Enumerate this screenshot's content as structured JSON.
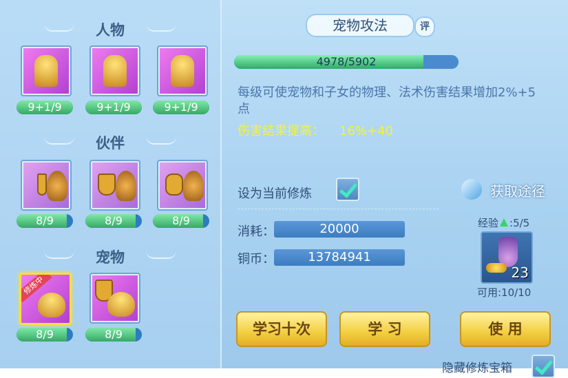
{
  "left": {
    "sections": [
      {
        "title": "人物",
        "cards": [
          {
            "name": "meditating-figure",
            "level": "9+1/9",
            "progress": 1
          },
          {
            "name": "shield-figure",
            "level": "9+1/9",
            "progress": 1
          },
          {
            "name": "warrior-figure",
            "level": "9+1/9",
            "progress": 1
          }
        ]
      },
      {
        "title": "伙伴",
        "cards": [
          {
            "name": "sword-tiger",
            "level": "8/9",
            "progress": 0.889
          },
          {
            "name": "shield-tiger",
            "level": "8/9",
            "progress": 0.889
          },
          {
            "name": "gauntlet-tiger",
            "level": "8/9",
            "progress": 0.889
          }
        ]
      },
      {
        "title": "宠物",
        "cards": [
          {
            "name": "sword-cat",
            "level": "8/9",
            "progress": 0.889,
            "badge": "修炼中"
          },
          {
            "name": "shield-cat",
            "level": "8/9",
            "progress": 0.889
          }
        ]
      }
    ]
  },
  "right": {
    "title": "宠物攻法",
    "comment_label": "评",
    "progress_text": "4978/5902",
    "progress_fraction": 0.843,
    "description": "每级可使宠物和子女的物理、法术伤害结果增加2%+5点",
    "effect_label": "伤害结果提高：",
    "effect_value": "16%+40",
    "set_current_label": "设为当前修炼",
    "set_current_checked": true,
    "source_label": "获取途径",
    "cost_label": "消耗：",
    "cost_value": "20000",
    "coins_label": "铜币：",
    "coins_value": "13784941",
    "exp_label": "经验",
    "exp_value": ":5/5",
    "item_count": "23",
    "available_label": "可用:10/10",
    "learn_ten_label": "学习十次",
    "learn_label": "学 习",
    "use_label": "使 用",
    "hide_label": "隐藏修炼宝箱",
    "hide_checked": true
  }
}
